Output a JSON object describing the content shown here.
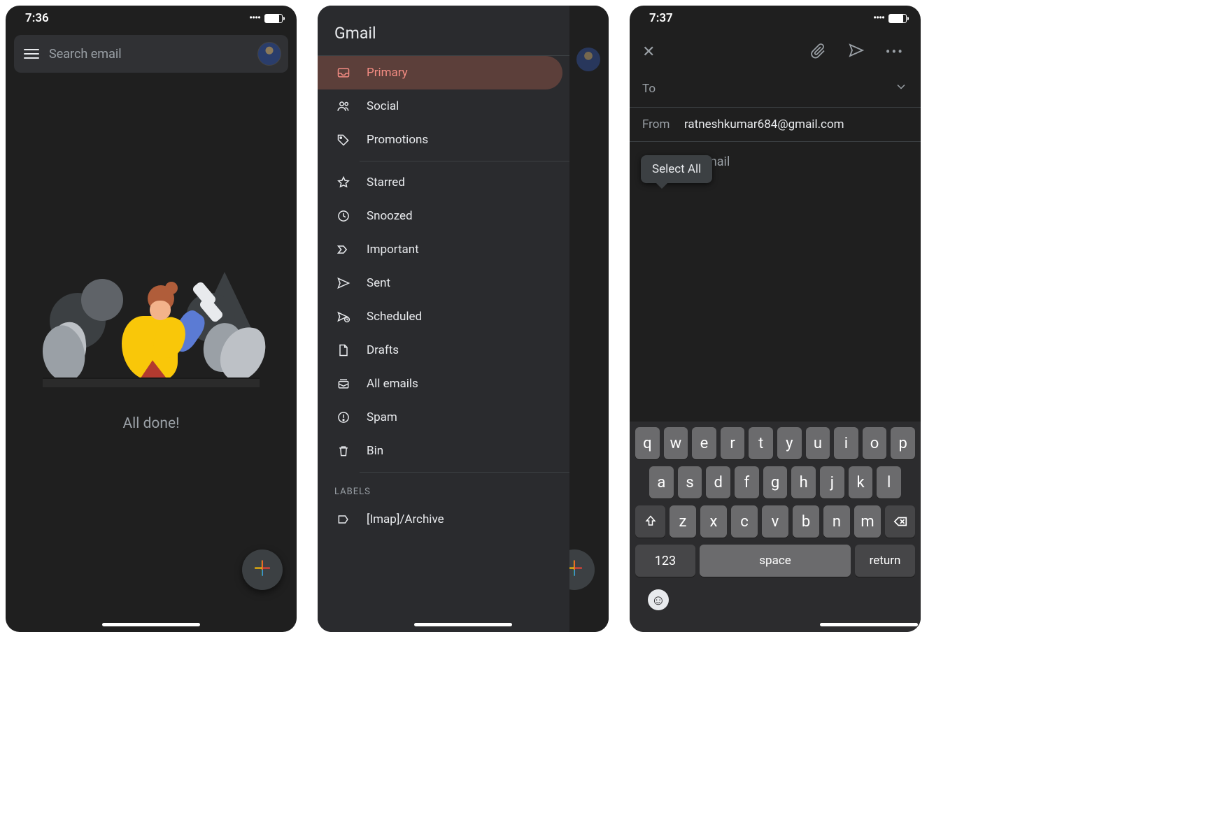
{
  "phone1": {
    "time": "7:36",
    "search_placeholder": "Search email",
    "empty_state": "All done!"
  },
  "drawer": {
    "title": "Gmail",
    "items": [
      {
        "label": "Primary",
        "icon": "inbox-icon",
        "active": true
      },
      {
        "label": "Social",
        "icon": "people-icon",
        "active": false
      },
      {
        "label": "Promotions",
        "icon": "tag-icon",
        "active": false
      }
    ],
    "sys_items": [
      {
        "label": "Starred",
        "icon": "star-icon"
      },
      {
        "label": "Snoozed",
        "icon": "clock-icon"
      },
      {
        "label": "Important",
        "icon": "important-icon"
      },
      {
        "label": "Sent",
        "icon": "send-icon"
      },
      {
        "label": "Scheduled",
        "icon": "scheduled-icon"
      },
      {
        "label": "Drafts",
        "icon": "file-icon"
      },
      {
        "label": "All emails",
        "icon": "stack-icon"
      },
      {
        "label": "Spam",
        "icon": "spam-icon"
      },
      {
        "label": "Bin",
        "icon": "trash-icon"
      }
    ],
    "labels_heading": "LABELS",
    "user_labels": [
      {
        "label": "[Imap]/Archive",
        "icon": "label-icon"
      }
    ]
  },
  "compose": {
    "time": "7:37",
    "to_label": "To",
    "from_label": "From",
    "from_value": "ratneshkumar684@gmail.com",
    "tooltip": "Select All",
    "body_placeholder": "Compose email",
    "keyboard": {
      "row1": [
        "q",
        "w",
        "e",
        "r",
        "t",
        "y",
        "u",
        "i",
        "o",
        "p"
      ],
      "row2": [
        "a",
        "s",
        "d",
        "f",
        "g",
        "h",
        "j",
        "k",
        "l"
      ],
      "row3": [
        "z",
        "x",
        "c",
        "v",
        "b",
        "n",
        "m"
      ],
      "k123": "123",
      "space": "space",
      "return": "return"
    }
  }
}
